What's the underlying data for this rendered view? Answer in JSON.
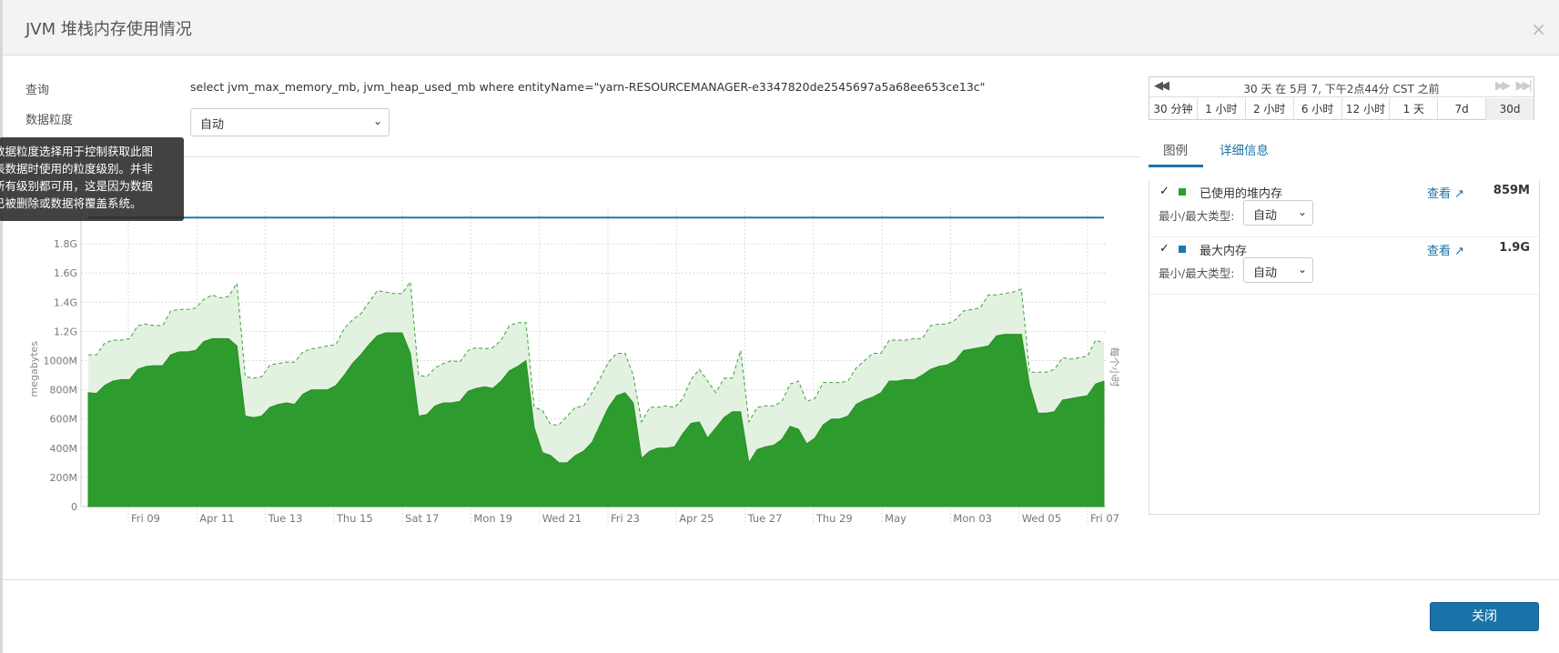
{
  "modal": {
    "title": "JVM 堆栈内存使用情况",
    "close_glyph": "×"
  },
  "query": {
    "label": "查询",
    "text": "select jvm_max_memory_mb, jvm_heap_used_mb where entityName=\"yarn-RESOURCEMANAGER-e3347820de2545697a5a68ee653ce13c\""
  },
  "granularity": {
    "label": "数据粒度",
    "selected": "自动"
  },
  "tooltip": {
    "lines": [
      "数据粒度选择用于控制获取此图",
      "表数据时使用的粒度级别。并非",
      "所有级别都可用，这是因为数据",
      "已被删除或数据将覆盖系统。"
    ]
  },
  "timebar": {
    "caption": "30 天 在 5月 7, 下午2点44分 CST 之前",
    "buttons": [
      "30 分钟",
      "1 小时",
      "2 小时",
      "6 小时",
      "12 小时",
      "1 天",
      "7d",
      "30d"
    ]
  },
  "tabs": {
    "legend": "图例",
    "details": "详细信息"
  },
  "legend": {
    "items": [
      {
        "check": "✓",
        "name": "已使用的堆内存",
        "view": "查看",
        "value": "859M",
        "minmax_label": "最小/最大类型:",
        "minmax_selected": "自动",
        "color": "#2e9b2e"
      },
      {
        "check": "✓",
        "name": "最大内存",
        "view": "查看",
        "value": "1.9G",
        "minmax_label": "最小/最大类型:",
        "minmax_selected": "自动",
        "color": "#1f77b4"
      }
    ]
  },
  "footer": {
    "close_label": "关闭"
  },
  "chart_data": {
    "type": "area",
    "ylabel": "megabytes",
    "right_label": "每个小时",
    "yticks": [
      "0",
      "200M",
      "400M",
      "600M",
      "800M",
      "1000M",
      "1.2G",
      "1.4G",
      "1.6G",
      "1.8G"
    ],
    "xticks": [
      "Fri 09",
      "Apr 11",
      "Tue 13",
      "Thu 15",
      "Sat 17",
      "Mon 19",
      "Wed 21",
      "Fri 23",
      "Apr 25",
      "Tue 27",
      "Thu 29",
      "May",
      "Mon 03",
      "Wed 05",
      "Fri 07"
    ],
    "ylim": [
      0,
      2000
    ],
    "grid": true,
    "series": [
      {
        "name": "最大内存",
        "color": "#1f77b4",
        "constant": 1980
      },
      {
        "name": "已使用的堆内存",
        "color": "#2e9b2e",
        "values": [
          780,
          775,
          830,
          860,
          870,
          870,
          940,
          960,
          965,
          965,
          1040,
          1060,
          1060,
          1070,
          1130,
          1150,
          1150,
          1150,
          1100,
          620,
          610,
          620,
          680,
          700,
          710,
          700,
          770,
          800,
          800,
          800,
          830,
          900,
          980,
          1040,
          1110,
          1170,
          1190,
          1190,
          1190,
          1050,
          620,
          630,
          690,
          710,
          710,
          720,
          790,
          810,
          820,
          810,
          860,
          930,
          960,
          1000,
          540,
          370,
          350,
          300,
          300,
          350,
          380,
          440,
          560,
          680,
          760,
          780,
          710,
          330,
          380,
          400,
          400,
          410,
          500,
          570,
          580,
          470,
          540,
          610,
          650,
          650,
          300,
          390,
          410,
          420,
          460,
          550,
          530,
          430,
          470,
          560,
          600,
          600,
          620,
          700,
          730,
          750,
          780,
          860,
          860,
          870,
          870,
          900,
          940,
          960,
          970,
          1000,
          1070,
          1080,
          1090,
          1100,
          1170,
          1180,
          1180,
          1180,
          830,
          640,
          640,
          650,
          730,
          740,
          750,
          760,
          840,
          859
        ],
        "upper": [
          1040,
          1040,
          1120,
          1140,
          1140,
          1150,
          1240,
          1250,
          1240,
          1240,
          1340,
          1350,
          1350,
          1360,
          1420,
          1450,
          1430,
          1440,
          1530,
          890,
          880,
          890,
          970,
          980,
          990,
          990,
          1060,
          1080,
          1090,
          1100,
          1110,
          1220,
          1280,
          1320,
          1400,
          1480,
          1470,
          1460,
          1460,
          1540,
          900,
          890,
          950,
          980,
          1000,
          990,
          1070,
          1090,
          1080,
          1090,
          1140,
          1240,
          1260,
          1260,
          680,
          660,
          560,
          560,
          620,
          680,
          690,
          780,
          880,
          990,
          1050,
          1050,
          900,
          580,
          680,
          680,
          690,
          680,
          740,
          870,
          940,
          860,
          780,
          880,
          880,
          1070,
          580,
          680,
          690,
          690,
          720,
          840,
          860,
          720,
          740,
          850,
          850,
          850,
          860,
          950,
          1000,
          1050,
          1050,
          1140,
          1140,
          1140,
          1150,
          1150,
          1240,
          1250,
          1250,
          1280,
          1340,
          1350,
          1360,
          1450,
          1450,
          1460,
          1470,
          1490,
          920,
          920,
          920,
          940,
          1020,
          1010,
          1020,
          1030,
          1140,
          1120
        ]
      }
    ]
  }
}
